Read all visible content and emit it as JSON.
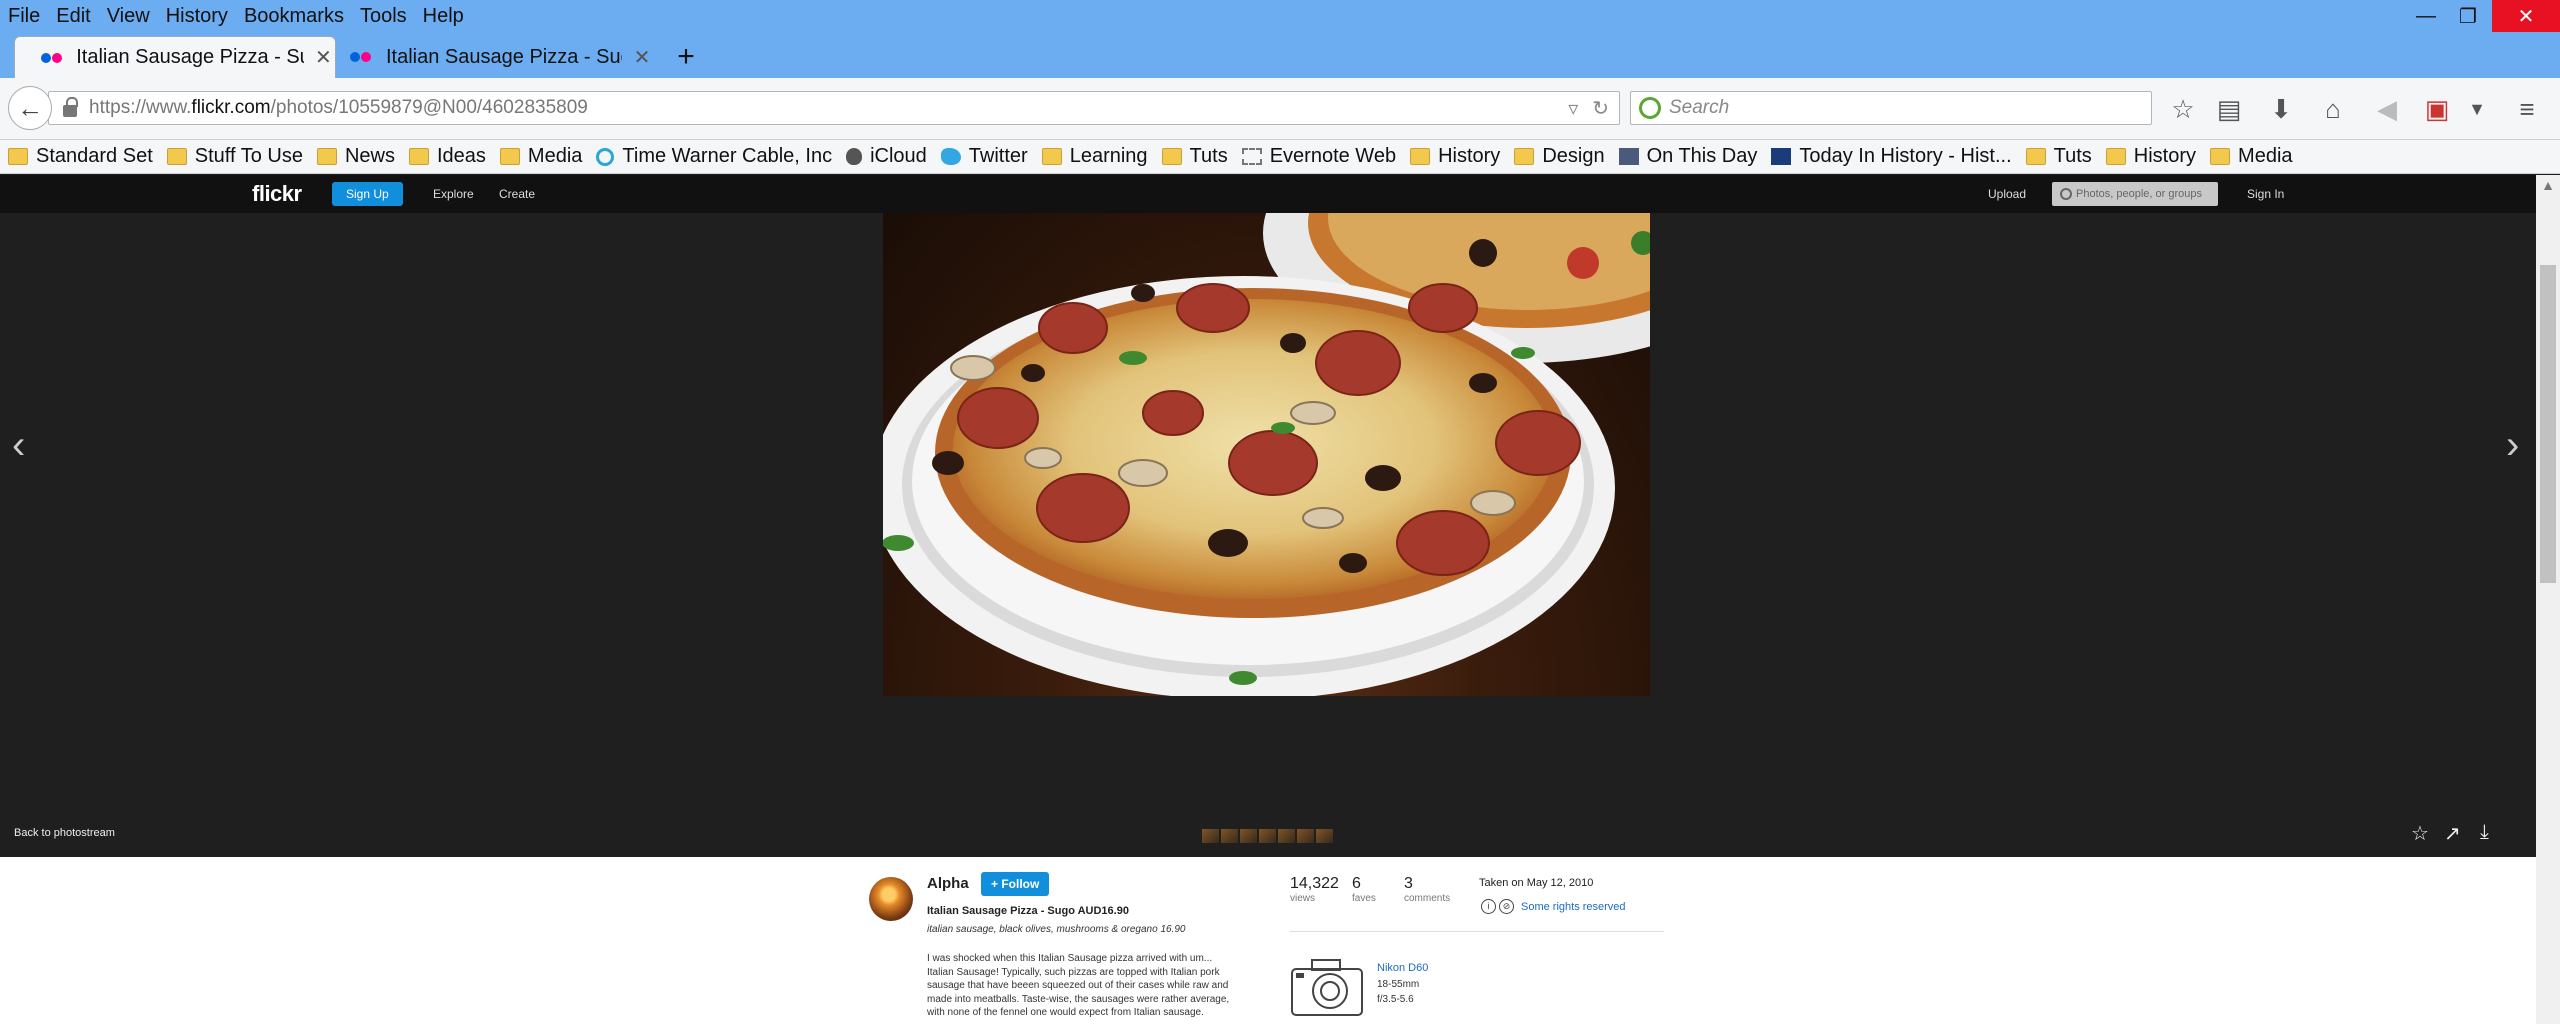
{
  "menu": [
    "File",
    "Edit",
    "View",
    "History",
    "Bookmarks",
    "Tools",
    "Help"
  ],
  "window_controls": {
    "minimize": "—",
    "restore": "❐",
    "close": "✕"
  },
  "tabs": [
    {
      "title": "Italian Sausage Pizza - Sug...",
      "active": true
    },
    {
      "title": "Italian Sausage Pizza - Sug...",
      "active": false
    }
  ],
  "new_tab": "+",
  "navbar": {
    "url_prefix": "https://www.",
    "url_domain": "flickr.com",
    "url_path": "/photos/10559879@N00/4602835809",
    "search_placeholder": "Search"
  },
  "bookmarks": [
    {
      "label": "Standard Set",
      "icon": "folder"
    },
    {
      "label": "Stuff To Use",
      "icon": "folder"
    },
    {
      "label": "News",
      "icon": "folder"
    },
    {
      "label": "Ideas",
      "icon": "folder"
    },
    {
      "label": "Media",
      "icon": "folder"
    },
    {
      "label": "Time Warner Cable, Inc",
      "icon": "twc"
    },
    {
      "label": "iCloud",
      "icon": "apple"
    },
    {
      "label": "Twitter",
      "icon": "twitter"
    },
    {
      "label": "Learning",
      "icon": "folder"
    },
    {
      "label": "Tuts",
      "icon": "folder"
    },
    {
      "label": "Evernote Web",
      "icon": "evernote"
    },
    {
      "label": "History",
      "icon": "folder"
    },
    {
      "label": "Design",
      "icon": "folder"
    },
    {
      "label": "On This Day",
      "icon": "otd"
    },
    {
      "label": "Today In History - Hist...",
      "icon": "hn"
    },
    {
      "label": "Tuts",
      "icon": "folder"
    },
    {
      "label": "History",
      "icon": "folder"
    },
    {
      "label": "Media",
      "icon": "folder"
    }
  ],
  "flickr": {
    "logo": "flickr",
    "signup": "Sign Up",
    "explore": "Explore",
    "create": "Create",
    "upload": "Upload",
    "search_placeholder": "Photos, people, or groups",
    "signin": "Sign In",
    "back_to_photostream": "Back to photostream",
    "owner": "Alpha",
    "follow": "+ Follow",
    "photo_title": "Italian Sausage Pizza - Sugo AUD16.90",
    "tags": "italian sausage, black olives, mushrooms & oregano 16.90",
    "description_lines": [
      "I was shocked when this Italian Sausage pizza arrived with um...",
      "Italian Sausage! Typically, such pizzas are topped with Italian pork",
      "sausage that have beeen squeezed out of their cases while raw and",
      "made into meatballs. Taste-wise, the sausages were rather average,",
      "with none of the fennel one would expect from Italian sausage."
    ],
    "stats": [
      {
        "num": "14,322",
        "label": "views"
      },
      {
        "num": "6",
        "label": "faves"
      },
      {
        "num": "3",
        "label": "comments"
      }
    ],
    "taken": "Taken on May 12, 2010",
    "rights": "Some rights reserved",
    "camera": {
      "model": "Nikon D60",
      "lens": "18-55mm",
      "aperture": "f/3.5-5.6"
    }
  }
}
